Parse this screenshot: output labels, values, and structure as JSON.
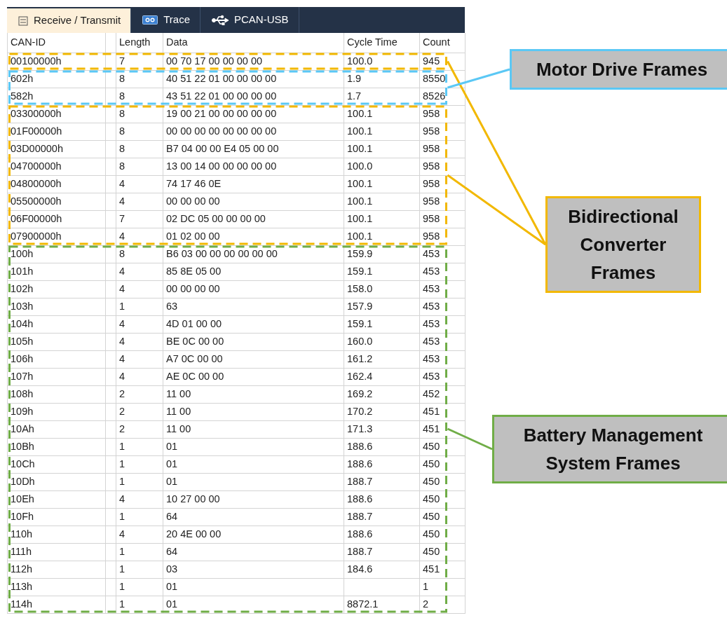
{
  "tabs": [
    {
      "label": "Receive / Transmit",
      "kind": "list",
      "selected": true
    },
    {
      "label": "Trace",
      "kind": "trace",
      "selected": false
    },
    {
      "label": "PCAN-USB",
      "kind": "usb",
      "selected": false
    }
  ],
  "table": {
    "columns": [
      "CAN-ID",
      "Length",
      "Data",
      "Cycle Time",
      "Count"
    ],
    "rows": [
      {
        "can_id": "00100000h",
        "length": "7",
        "data": "00 70 17 00 00 00 00",
        "cycle_time": "100.0",
        "count": "945",
        "kind": "converter"
      },
      {
        "can_id": "602h",
        "length": "8",
        "data": "40 51 22 01 00 00 00 00",
        "cycle_time": "1.9",
        "count": "8550",
        "kind": "motor"
      },
      {
        "can_id": "582h",
        "length": "8",
        "data": "43 51 22 01 00 00 00 00",
        "cycle_time": "1.7",
        "count": "8526",
        "kind": "motor"
      },
      {
        "can_id": "03300000h",
        "length": "8",
        "data": "19 00 21 00 00 00 00 00",
        "cycle_time": "100.1",
        "count": "958",
        "kind": "converter"
      },
      {
        "can_id": "01F00000h",
        "length": "8",
        "data": "00 00 00 00 00 00 00 00",
        "cycle_time": "100.1",
        "count": "958",
        "kind": "converter"
      },
      {
        "can_id": "03D00000h",
        "length": "8",
        "data": "B7 04 00 00 E4 05 00 00",
        "cycle_time": "100.1",
        "count": "958",
        "kind": "converter"
      },
      {
        "can_id": "04700000h",
        "length": "8",
        "data": "13 00 14 00 00 00 00 00",
        "cycle_time": "100.0",
        "count": "958",
        "kind": "converter"
      },
      {
        "can_id": "04800000h",
        "length": "4",
        "data": "74 17 46 0E",
        "cycle_time": "100.1",
        "count": "958",
        "kind": "converter"
      },
      {
        "can_id": "05500000h",
        "length": "4",
        "data": "00 00 00 00",
        "cycle_time": "100.1",
        "count": "958",
        "kind": "converter"
      },
      {
        "can_id": "06F00000h",
        "length": "7",
        "data": "02 DC 05 00 00 00 00",
        "cycle_time": "100.1",
        "count": "958",
        "kind": "converter"
      },
      {
        "can_id": "07900000h",
        "length": "4",
        "data": "01 02 00 00",
        "cycle_time": "100.1",
        "count": "958",
        "kind": "converter"
      },
      {
        "can_id": "100h",
        "length": "8",
        "data": "B6 03 00 00 00 00 00 00",
        "cycle_time": "159.9",
        "count": "453",
        "kind": "bms"
      },
      {
        "can_id": "101h",
        "length": "4",
        "data": "85 8E 05 00",
        "cycle_time": "159.1",
        "count": "453",
        "kind": "bms"
      },
      {
        "can_id": "102h",
        "length": "4",
        "data": "00 00 00 00",
        "cycle_time": "158.0",
        "count": "453",
        "kind": "bms"
      },
      {
        "can_id": "103h",
        "length": "1",
        "data": "63",
        "cycle_time": "157.9",
        "count": "453",
        "kind": "bms"
      },
      {
        "can_id": "104h",
        "length": "4",
        "data": "4D 01 00 00",
        "cycle_time": "159.1",
        "count": "453",
        "kind": "bms"
      },
      {
        "can_id": "105h",
        "length": "4",
        "data": "BE 0C 00 00",
        "cycle_time": "160.0",
        "count": "453",
        "kind": "bms"
      },
      {
        "can_id": "106h",
        "length": "4",
        "data": "A7 0C 00 00",
        "cycle_time": "161.2",
        "count": "453",
        "kind": "bms"
      },
      {
        "can_id": "107h",
        "length": "4",
        "data": "AE 0C 00 00",
        "cycle_time": "162.4",
        "count": "453",
        "kind": "bms"
      },
      {
        "can_id": "108h",
        "length": "2",
        "data": "11 00",
        "cycle_time": "169.2",
        "count": "452",
        "kind": "bms"
      },
      {
        "can_id": "109h",
        "length": "2",
        "data": "11 00",
        "cycle_time": "170.2",
        "count": "451",
        "kind": "bms"
      },
      {
        "can_id": "10Ah",
        "length": "2",
        "data": "11 00",
        "cycle_time": "171.3",
        "count": "451",
        "kind": "bms"
      },
      {
        "can_id": "10Bh",
        "length": "1",
        "data": "01",
        "cycle_time": "188.6",
        "count": "450",
        "kind": "bms"
      },
      {
        "can_id": "10Ch",
        "length": "1",
        "data": "01",
        "cycle_time": "188.6",
        "count": "450",
        "kind": "bms"
      },
      {
        "can_id": "10Dh",
        "length": "1",
        "data": "01",
        "cycle_time": "188.7",
        "count": "450",
        "kind": "bms"
      },
      {
        "can_id": "10Eh",
        "length": "4",
        "data": "10 27 00 00",
        "cycle_time": "188.6",
        "count": "450",
        "kind": "bms"
      },
      {
        "can_id": "10Fh",
        "length": "1",
        "data": "64",
        "cycle_time": "188.7",
        "count": "450",
        "kind": "bms"
      },
      {
        "can_id": "110h",
        "length": "4",
        "data": "20 4E 00 00",
        "cycle_time": "188.6",
        "count": "450",
        "kind": "bms"
      },
      {
        "can_id": "111h",
        "length": "1",
        "data": "64",
        "cycle_time": "188.7",
        "count": "450",
        "kind": "bms"
      },
      {
        "can_id": "112h",
        "length": "1",
        "data": "03",
        "cycle_time": "184.6",
        "count": "451",
        "kind": "bms"
      },
      {
        "can_id": "113h",
        "length": "1",
        "data": "01",
        "count": "1",
        "kind": "bms"
      },
      {
        "can_id": "114h",
        "length": "1",
        "data": "01",
        "cycle_time": "8872.1",
        "count": "2",
        "kind": "bms"
      }
    ]
  },
  "callouts": [
    {
      "kind": "motor",
      "label": "Motor Drive Frames",
      "color": "#5bc8f5"
    },
    {
      "kind": "converter",
      "label": "Bidirectional Converter Frames",
      "color": "#f2b800"
    },
    {
      "kind": "bms",
      "label": "Battery Management System Frames",
      "color": "#70ad47"
    }
  ]
}
